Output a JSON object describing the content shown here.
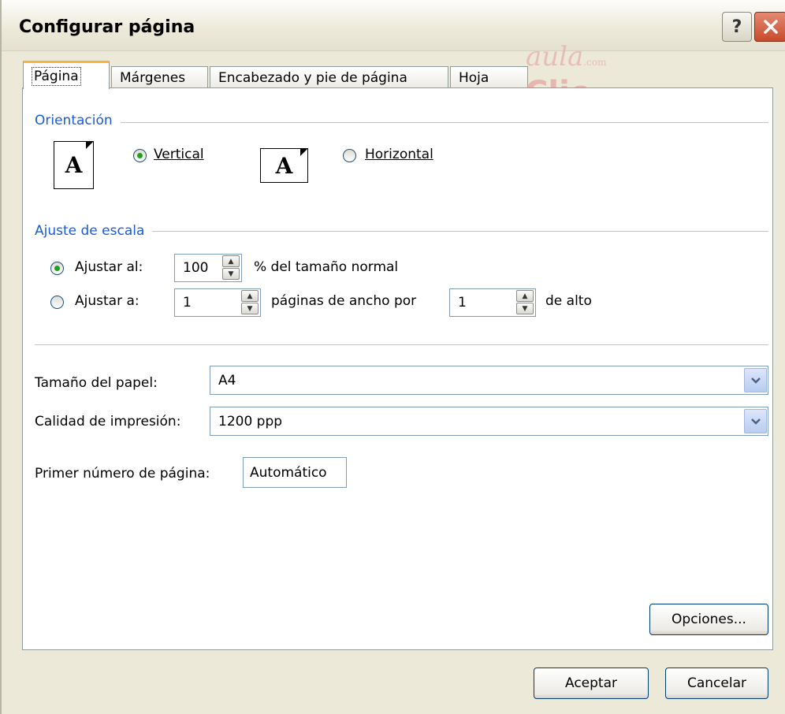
{
  "window": {
    "title": "Configurar página",
    "help_label": "?"
  },
  "watermark": {
    "line1": "aula",
    "line2": "Clic",
    "small": ".com"
  },
  "tabs": [
    {
      "label": "Página",
      "active": true
    },
    {
      "label": "Márgenes",
      "active": false
    },
    {
      "label": "Encabezado y pie de página",
      "active": false
    },
    {
      "label": "Hoja",
      "active": false
    }
  ],
  "orientation": {
    "legend": "Orientación",
    "vertical": {
      "label": "Vertical",
      "selected": true
    },
    "horizontal": {
      "label": "Horizontal",
      "selected": false
    },
    "icon_letter": "A"
  },
  "scaling": {
    "legend": "Ajuste de escala",
    "adjust_to": {
      "label": "Ajustar al:",
      "value": "100",
      "suffix": "% del tamaño normal",
      "selected": true
    },
    "fit_to": {
      "label": "Ajustar a:",
      "width_value": "1",
      "width_suffix": "páginas de ancho por",
      "height_value": "1",
      "height_suffix": "de alto",
      "selected": false
    }
  },
  "paper_size": {
    "label": "Tamaño del papel:",
    "value": "A4"
  },
  "print_quality": {
    "label": "Calidad de impresión:",
    "value": "1200 ppp"
  },
  "first_page_number": {
    "label": "Primer número de página:",
    "value": "Automático"
  },
  "buttons": {
    "options": "Opciones...",
    "ok": "Aceptar",
    "cancel": "Cancelar"
  },
  "colors": {
    "legend_blue": "#1a5cd6",
    "active_tab_accent": "#f7b33c",
    "radio_selected": "#21a121",
    "dialog_bg": "#ece9d8"
  }
}
